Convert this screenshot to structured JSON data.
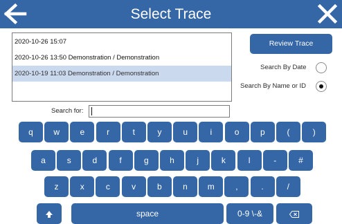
{
  "header": {
    "title": "Select Trace",
    "back_icon": "back-arrow-icon",
    "close_icon": "close-icon",
    "bar_color": "#3566a6"
  },
  "traces": [
    {
      "label": "2020-10-26 15:07",
      "selected": false
    },
    {
      "label": "2020-10-26 13:50 Demonstration / Demonstration",
      "selected": false
    },
    {
      "label": "2020-10-19 11:03 Demonstration / Demonstration",
      "selected": true
    }
  ],
  "review_button": "Review Trace",
  "search_options": [
    {
      "label": "Search By Date",
      "selected": false
    },
    {
      "label": "Search By Name or ID",
      "selected": true
    }
  ],
  "search": {
    "label": "Search for:",
    "value": ""
  },
  "keyboard": {
    "row1": [
      "q",
      "w",
      "e",
      "r",
      "t",
      "y",
      "u",
      "i",
      "o",
      "p",
      "(",
      ")"
    ],
    "row2": [
      "a",
      "s",
      "d",
      "f",
      "g",
      "h",
      "j",
      "k",
      "l",
      "-",
      "#"
    ],
    "row3": [
      "z",
      "x",
      "c",
      "v",
      "b",
      "n",
      "m",
      ",",
      ".",
      "/"
    ],
    "shift_icon": "shift-up-icon",
    "space": "space",
    "symbols": "0-9 \\-&",
    "backspace_icon": "backspace-icon",
    "key_color": "#3566a6"
  }
}
